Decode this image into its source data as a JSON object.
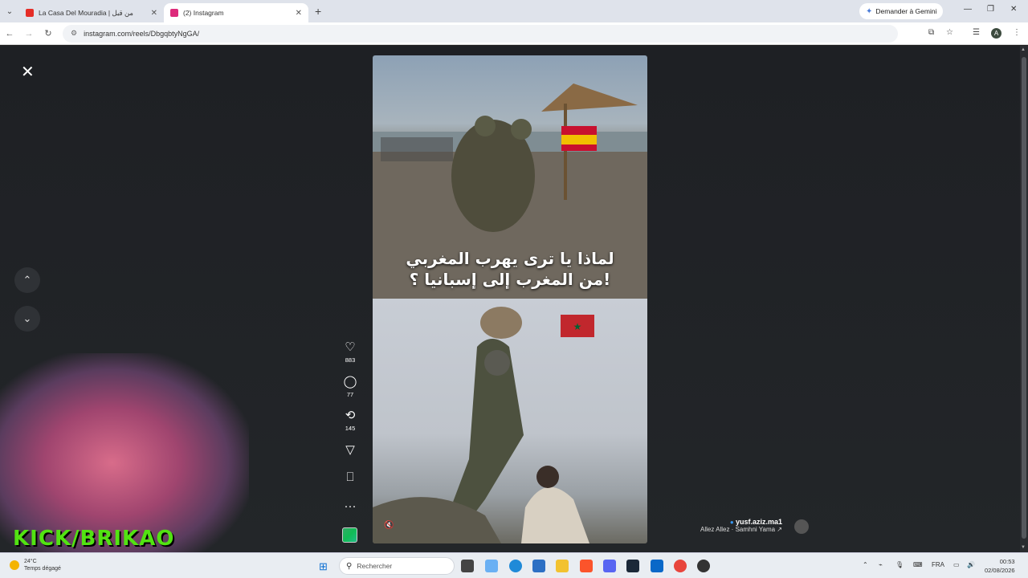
{
  "browser": {
    "tabs": [
      {
        "title": "La Casa Del Mouradia | من قبل",
        "favicon_color": "#e52d27",
        "active": false
      },
      {
        "title": "(2) Instagram",
        "favicon_color": "#dd2a7b",
        "active": true
      }
    ],
    "gemini_label": "Demander à Gemini",
    "url": "instagram.com/reels/DbgqbtyNgGA/",
    "profile_initial": "A"
  },
  "reel": {
    "caption_line1": "لماذا يا ترى يهرب المغربي",
    "caption_line2": "من المغرب إلى إسبانيا ؟!",
    "likes": "883",
    "comments": "77",
    "reposts": "145"
  },
  "author": {
    "name": "yusf.aziz.ma1",
    "song": "Allez Allez · Samhni Yama ↗"
  },
  "overlay": {
    "kick_text": "KICK/BRIKAO"
  },
  "taskbar": {
    "temperature": "24°C",
    "weather_desc": "Temps dégagé",
    "search_placeholder": "Rechercher",
    "language": "FRA",
    "time": "00:53",
    "date": "02/08/2026"
  }
}
